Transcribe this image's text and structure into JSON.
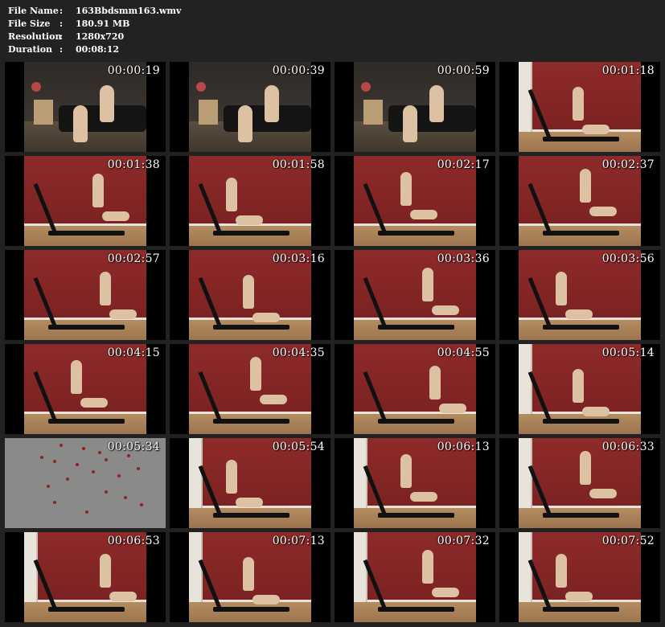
{
  "info": {
    "rows": [
      {
        "key": "File Name",
        "sep": ":",
        "value": "163Bbdsmm163.wmv"
      },
      {
        "key": "File Size",
        "sep": ":",
        "value": "180.91 MB"
      },
      {
        "key": "Resolution",
        "sep": ":",
        "value": "1280x720"
      },
      {
        "key": "Duration",
        "sep": ":",
        "value": "00:08:12"
      }
    ]
  },
  "thumbnails": [
    {
      "time": "00:00:19",
      "scene": "living"
    },
    {
      "time": "00:00:39",
      "scene": "living"
    },
    {
      "time": "00:00:59",
      "scene": "living"
    },
    {
      "time": "00:01:18",
      "scene": "red"
    },
    {
      "time": "00:01:38",
      "scene": "red"
    },
    {
      "time": "00:01:58",
      "scene": "red"
    },
    {
      "time": "00:02:17",
      "scene": "red"
    },
    {
      "time": "00:02:37",
      "scene": "red"
    },
    {
      "time": "00:02:57",
      "scene": "red"
    },
    {
      "time": "00:03:16",
      "scene": "red"
    },
    {
      "time": "00:03:36",
      "scene": "red"
    },
    {
      "time": "00:03:56",
      "scene": "red"
    },
    {
      "time": "00:04:15",
      "scene": "red"
    },
    {
      "time": "00:04:35",
      "scene": "red"
    },
    {
      "time": "00:04:55",
      "scene": "red"
    },
    {
      "time": "00:05:14",
      "scene": "red"
    },
    {
      "time": "00:05:34",
      "scene": "grey"
    },
    {
      "time": "00:05:54",
      "scene": "red"
    },
    {
      "time": "00:06:13",
      "scene": "red"
    },
    {
      "time": "00:06:33",
      "scene": "red"
    },
    {
      "time": "00:06:53",
      "scene": "red"
    },
    {
      "time": "00:07:13",
      "scene": "red"
    },
    {
      "time": "00:07:32",
      "scene": "red"
    },
    {
      "time": "00:07:52",
      "scene": "red"
    }
  ],
  "colors": {
    "background": "#222222",
    "wall_red": "#8e2a2a",
    "floor_wood": "#b58c60",
    "grey_frame": "#8a8a8a"
  }
}
